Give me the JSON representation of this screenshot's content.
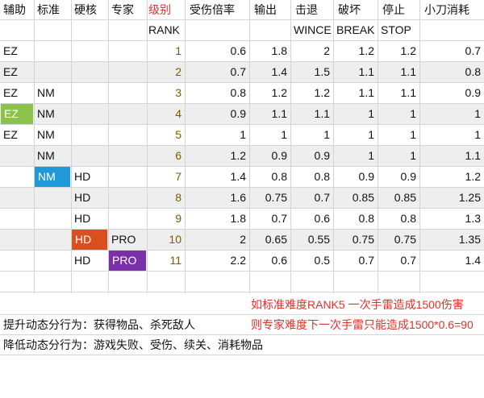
{
  "colors": {
    "stripe": "#eeeeee",
    "ez_highlight": "#8bc34a",
    "nm_highlight": "#1f9ad6",
    "hd_highlight": "#d9501e",
    "pro_highlight": "#7b2fa8",
    "header_red": "#e0302a",
    "rank_text": "#7a5c00"
  },
  "table": {
    "header1": [
      "辅助",
      "标准",
      "硬核",
      "专家",
      "级别",
      "受伤倍率",
      "输出",
      "击退",
      "破坏",
      "停止",
      "小刀消耗"
    ],
    "header2": [
      "",
      "",
      "",
      "",
      "RANK",
      "",
      "",
      "WINCE",
      "BREAK",
      "STOP",
      ""
    ],
    "rows": [
      {
        "c1": "EZ",
        "c2": "",
        "c3": "",
        "c4": "",
        "rank": "1",
        "v": [
          "0.6",
          "1.8",
          "2",
          "1.2",
          "1.2",
          "0.7"
        ]
      },
      {
        "c1": "EZ",
        "c2": "",
        "c3": "",
        "c4": "",
        "rank": "2",
        "v": [
          "0.7",
          "1.4",
          "1.5",
          "1.1",
          "1.1",
          "0.8"
        ]
      },
      {
        "c1": "EZ",
        "c2": "NM",
        "c3": "",
        "c4": "",
        "rank": "3",
        "v": [
          "0.8",
          "1.2",
          "1.2",
          "1.1",
          "1.1",
          "0.9"
        ]
      },
      {
        "c1": "EZ",
        "c2": "NM",
        "c3": "",
        "c4": "",
        "rank": "4",
        "v": [
          "0.9",
          "1.1",
          "1.1",
          "1",
          "1",
          "1"
        ]
      },
      {
        "c1": "EZ",
        "c2": "NM",
        "c3": "",
        "c4": "",
        "rank": "5",
        "v": [
          "1",
          "1",
          "1",
          "1",
          "1",
          "1"
        ]
      },
      {
        "c1": "",
        "c2": "NM",
        "c3": "",
        "c4": "",
        "rank": "6",
        "v": [
          "1.2",
          "0.9",
          "0.9",
          "1",
          "1",
          "1.1"
        ]
      },
      {
        "c1": "",
        "c2": "NM",
        "c3": "HD",
        "c4": "",
        "rank": "7",
        "v": [
          "1.4",
          "0.8",
          "0.8",
          "0.9",
          "0.9",
          "1.2"
        ]
      },
      {
        "c1": "",
        "c2": "",
        "c3": "HD",
        "c4": "",
        "rank": "8",
        "v": [
          "1.6",
          "0.75",
          "0.7",
          "0.85",
          "0.85",
          "1.25"
        ]
      },
      {
        "c1": "",
        "c2": "",
        "c3": "HD",
        "c4": "",
        "rank": "9",
        "v": [
          "1.8",
          "0.7",
          "0.6",
          "0.8",
          "0.8",
          "1.3"
        ]
      },
      {
        "c1": "",
        "c2": "",
        "c3": "HD",
        "c4": "PRO",
        "rank": "10",
        "v": [
          "2",
          "0.65",
          "0.55",
          "0.75",
          "0.75",
          "1.35"
        ]
      },
      {
        "c1": "",
        "c2": "",
        "c3": "HD",
        "c4": "PRO",
        "rank": "11",
        "v": [
          "2.2",
          "0.6",
          "0.5",
          "0.7",
          "0.7",
          "1.4"
        ]
      }
    ]
  },
  "notes": {
    "red1": "如标准难度RANK5 一次手雷造成1500伤害",
    "red2": "则专家难度下一次手雷只能造成1500*0.6=90",
    "black1": "提升动态分行为：获得物品、杀死敌人",
    "black2": "降低动态分行为：游戏失败、受伤、续关、消耗物品"
  }
}
